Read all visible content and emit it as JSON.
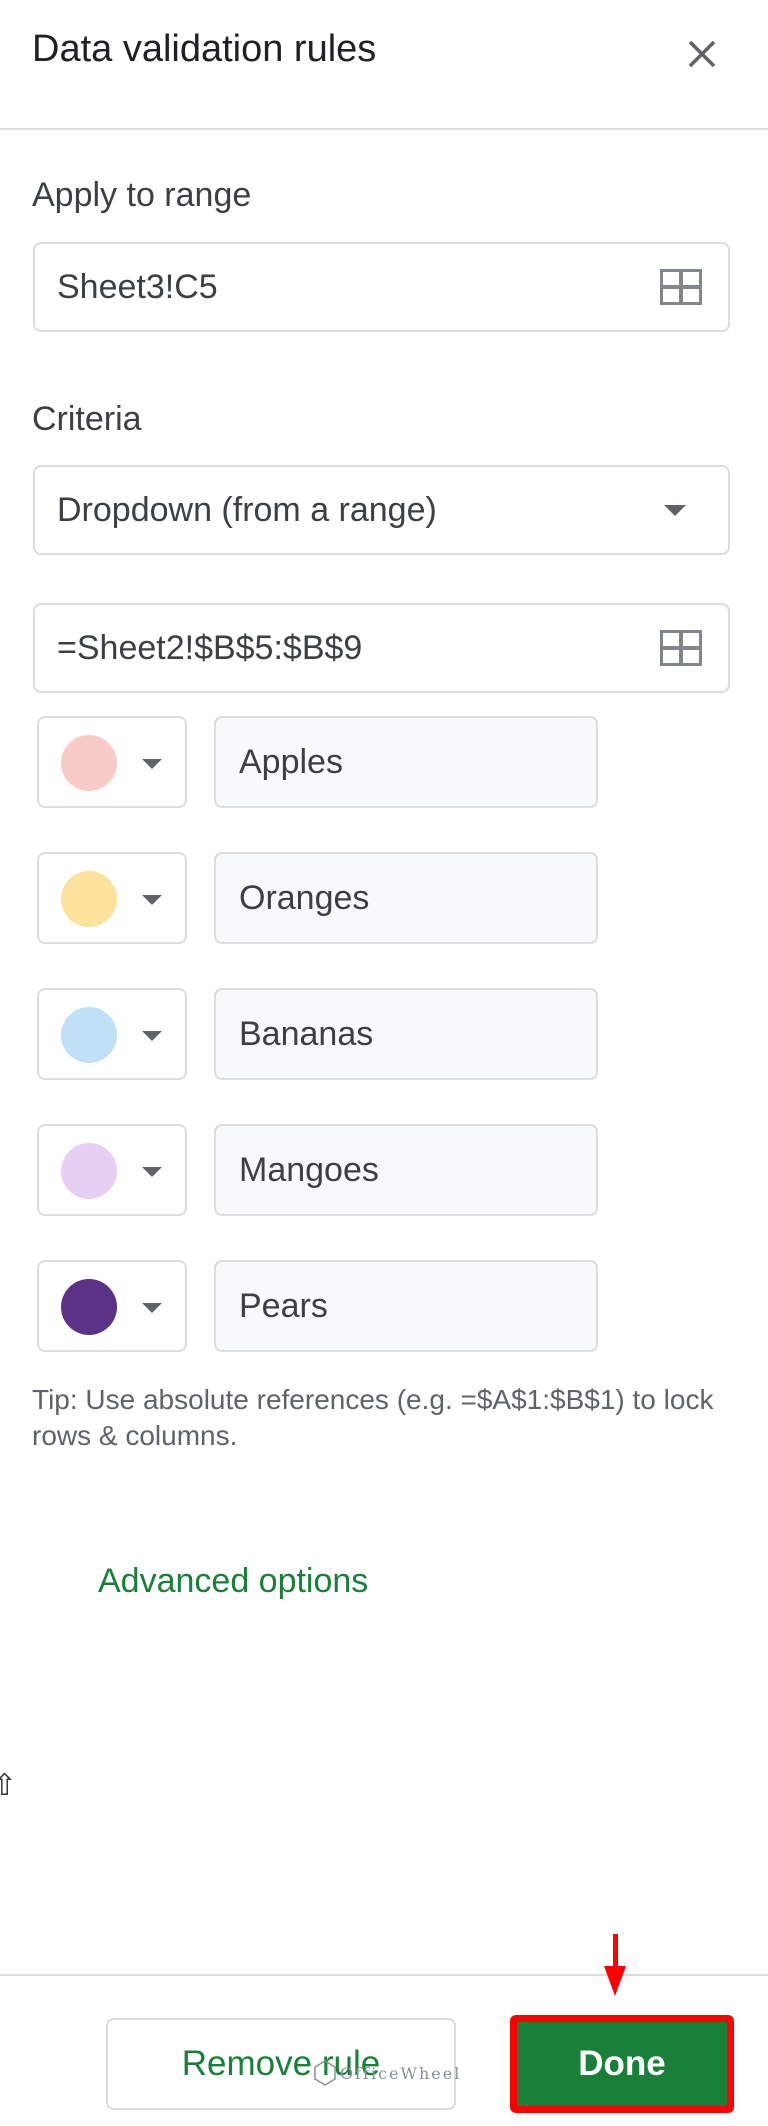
{
  "header": {
    "title": "Data validation rules",
    "close_icon": "close-icon"
  },
  "apply_to_range": {
    "label": "Apply to range",
    "value": "Sheet3!C5",
    "icon": "select-range-icon"
  },
  "criteria": {
    "label": "Criteria",
    "type_selected": "Dropdown (from a range)",
    "range_value": "=Sheet2!$B$5:$B$9"
  },
  "items": [
    {
      "label": "Apples",
      "color": "#f9cbc8"
    },
    {
      "label": "Oranges",
      "color": "#fde29b"
    },
    {
      "label": "Bananas",
      "color": "#bfe0f6"
    },
    {
      "label": "Mangoes",
      "color": "#e6cff2"
    },
    {
      "label": "Pears",
      "color": "#5a3286"
    }
  ],
  "tip": "Tip: Use absolute references (e.g. =$A$1:$B$1) to lock rows & columns.",
  "advanced_options": "Advanced options",
  "footer": {
    "remove_label": "Remove rule",
    "done_label": "Done"
  },
  "watermark": "OfficeWheel",
  "colors": {
    "accent_green": "#188038",
    "highlight_red": "#ff0000",
    "border": "#dadce0"
  }
}
